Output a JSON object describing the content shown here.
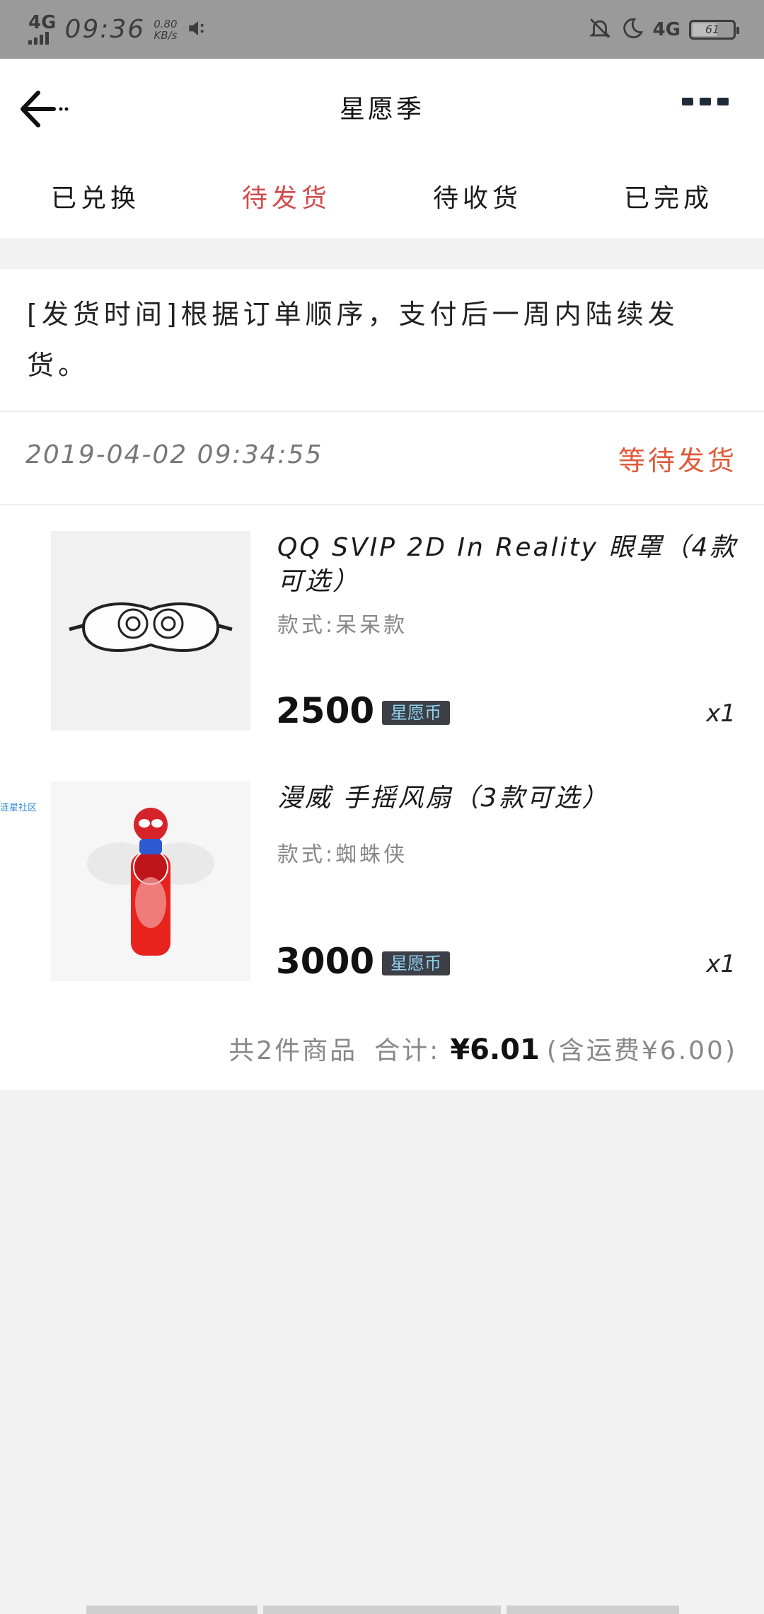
{
  "status_bar": {
    "network_left": "4G",
    "time": "09:36",
    "speed_value": "0.80",
    "speed_unit": "KB/s",
    "network_right": "4G",
    "battery": "61",
    "icons": [
      "signal-icon",
      "mute-speaker-icon",
      "bell-off-icon",
      "moon-icon",
      "battery-icon"
    ]
  },
  "header": {
    "title": "星愿季",
    "back_icon": "arrow-left-icon",
    "more_icon": "more-dots-icon"
  },
  "tabs": [
    {
      "label": "已兑换",
      "active": false
    },
    {
      "label": "待发货",
      "active": true
    },
    {
      "label": "待收货",
      "active": false
    },
    {
      "label": "已完成",
      "active": false
    }
  ],
  "notice": "[发货时间]根据订单顺序，支付后一周内陆续发货。",
  "order": {
    "date": "2019-04-02 09:34:55",
    "status": "等待发货",
    "items": [
      {
        "title": "QQ SVIP 2D In Reality 眼罩（4款可选）",
        "spec": "款式:呆呆款",
        "price": "2500",
        "currency_badge": "星愿币",
        "qty": "x1",
        "image": "eye-mask-image"
      },
      {
        "title": "漫威 手摇风扇（3款可选）",
        "spec": "款式:蜘蛛侠",
        "price": "3000",
        "currency_badge": "星愿币",
        "qty": "x1",
        "image": "spiderman-fan-image"
      }
    ],
    "summary": {
      "count": "共2件商品",
      "total_label": "合计:",
      "total": "¥6.01",
      "shipping": "(含运费¥6.00)"
    }
  },
  "side_tag": "涟星社区",
  "colors": {
    "accent_red": "#d24b4b",
    "status_orange": "#e05a3a",
    "badge_bg": "#3c3f45",
    "badge_text": "#8fd0f0"
  }
}
